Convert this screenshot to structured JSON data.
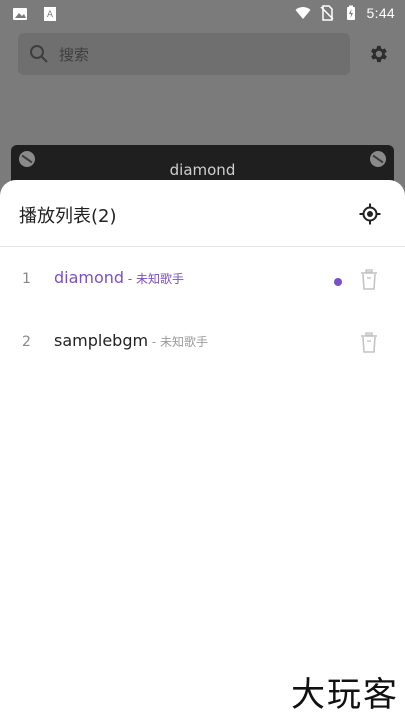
{
  "status_bar": {
    "time": "5:44",
    "icons": [
      "image-icon",
      "keyboard-icon",
      "wifi-icon",
      "no-sim-icon",
      "battery-icon"
    ]
  },
  "search": {
    "placeholder": "搜索"
  },
  "player": {
    "title": "diamond"
  },
  "playlist": {
    "title": "播放列表(2)",
    "items": [
      {
        "index": "1",
        "name": "diamond",
        "artist": " - 未知歌手",
        "playing": true
      },
      {
        "index": "2",
        "name": "samplebgm",
        "artist": " - 未知歌手",
        "playing": false
      }
    ]
  },
  "watermark": "大玩客",
  "colors": {
    "accent": "#7a4fc9",
    "overlay": "#7b7b7b"
  }
}
